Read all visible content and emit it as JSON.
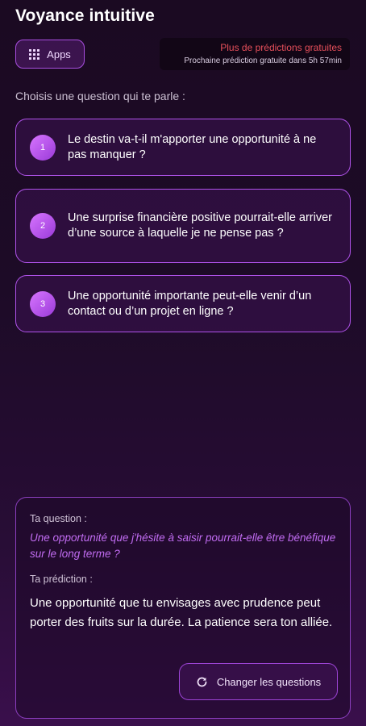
{
  "header": {
    "title": "Voyance intuitive"
  },
  "apps_button": {
    "icon": "grid-icon",
    "label": "Apps"
  },
  "promo": {
    "title": "Plus de prédictions gratuites",
    "subtitle": "Prochaine prédiction gratuite dans 5h 57min"
  },
  "prompt": "Choisis une question qui te parle :",
  "questions": [
    {
      "number": "1",
      "text": "Le destin va-t-il m'apporter une opportunité à ne pas manquer ?"
    },
    {
      "number": "2",
      "text": "Une surprise financière positive pourrait-elle arriver d’une source à laquelle je ne pense pas ?"
    },
    {
      "number": "3",
      "text": "Une opportunité importante peut-elle venir d’un contact ou d’un projet en ligne ?"
    }
  ],
  "prediction": {
    "question_label": "Ta question :",
    "question_text": "Une opportunité que j'hésite à saisir pourrait-elle être bénéfique sur le long terme ?",
    "prediction_label": "Ta prédiction :",
    "prediction_text": "Une opportunité que tu envisages avec prudence peut porter des fruits sur la durée. La patience sera ton alliée.",
    "change_button_label": "Changer les questions",
    "change_button_icon": "refresh-icon"
  },
  "colors": {
    "accent": "#b053ea",
    "promo_title": "#e8505b",
    "question_italic": "#c16cf2",
    "background_top": "#1b0a22",
    "background_bottom": "#3a0f4c"
  }
}
